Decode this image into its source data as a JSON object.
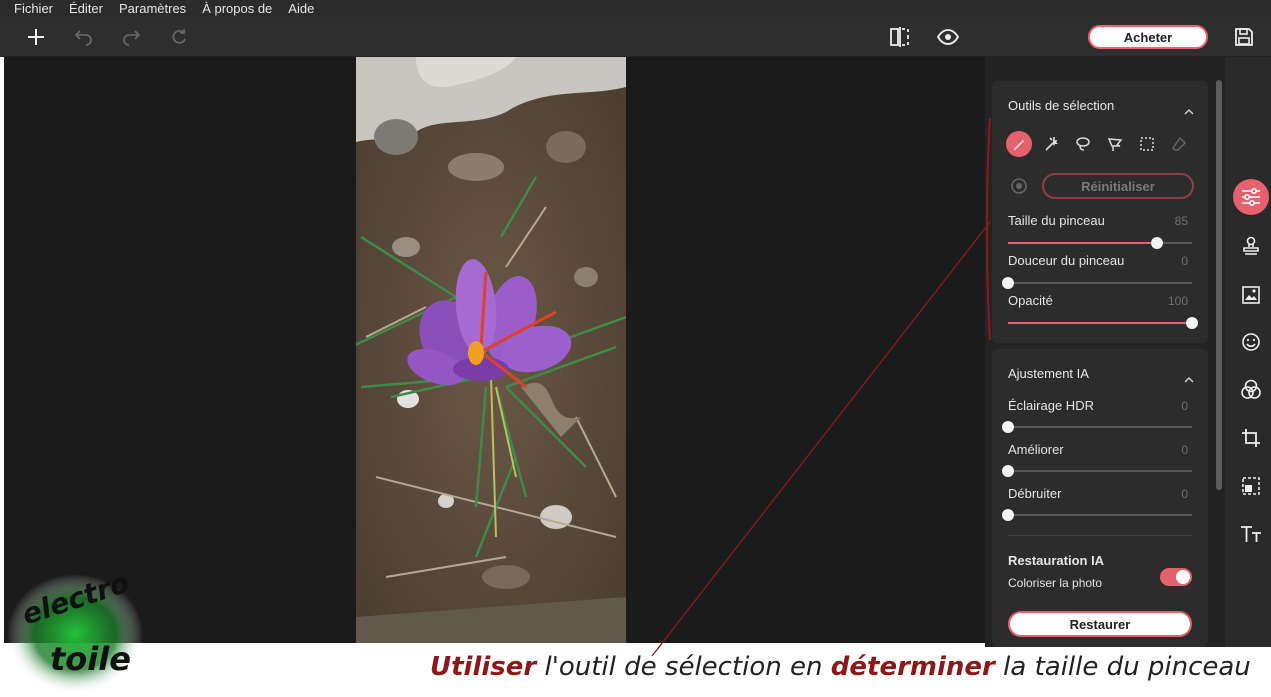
{
  "menu": [
    "Fichier",
    "Éditer",
    "Paramètres",
    "À propos de",
    "Aide"
  ],
  "toolbar": {
    "buy_label": "Acheter",
    "icons": [
      "plus-icon",
      "undo-icon",
      "redo-icon",
      "refresh-icon",
      "compare-icon",
      "eye-icon",
      "save-icon"
    ]
  },
  "selection_panel": {
    "title": "Outils de sélection",
    "tools": [
      "brush-icon",
      "magic-wand-icon",
      "lasso-icon",
      "polygon-lasso-icon",
      "rect-select-icon",
      "eraser-icon"
    ],
    "active_tool": "brush-icon",
    "reset_label": "Réinitialiser",
    "sliders": [
      {
        "label": "Taille du pinceau",
        "value": "85",
        "fraction": 0.81
      },
      {
        "label": "Douceur du pinceau",
        "value": "0",
        "fraction": 0
      },
      {
        "label": "Opacité",
        "value": "100",
        "fraction": 1
      }
    ]
  },
  "ai_panel": {
    "title": "Ajustement IA",
    "sliders": [
      {
        "label": "Éclairage HDR",
        "value": "0",
        "fraction": 0
      },
      {
        "label": "Améliorer",
        "value": "0",
        "fraction": 0
      },
      {
        "label": "Débruiter",
        "value": "0",
        "fraction": 0
      }
    ],
    "restore_title": "Restauration IA",
    "colorize_label": "Coloriser la photo",
    "colorize_on": true,
    "restore_label": "Restaurer"
  },
  "rail_icons": [
    "adjust-sliders-icon",
    "stamp-icon",
    "image-icon",
    "face-icon",
    "color-circles-icon",
    "crop-icon",
    "resize-icon",
    "text-icon"
  ],
  "caption": {
    "part1": "Utiliser",
    "part2": " l'outil de sélection en ",
    "part3": "déterminer",
    "part4": " la taille du pinceau"
  },
  "watermark": {
    "line1": "electro",
    "line2": "toile"
  },
  "colors": {
    "accent": "#e5616d",
    "panel": "#2c2c2c",
    "canvas": "#1b1b1b",
    "caption_highlight": "#8e1818"
  }
}
